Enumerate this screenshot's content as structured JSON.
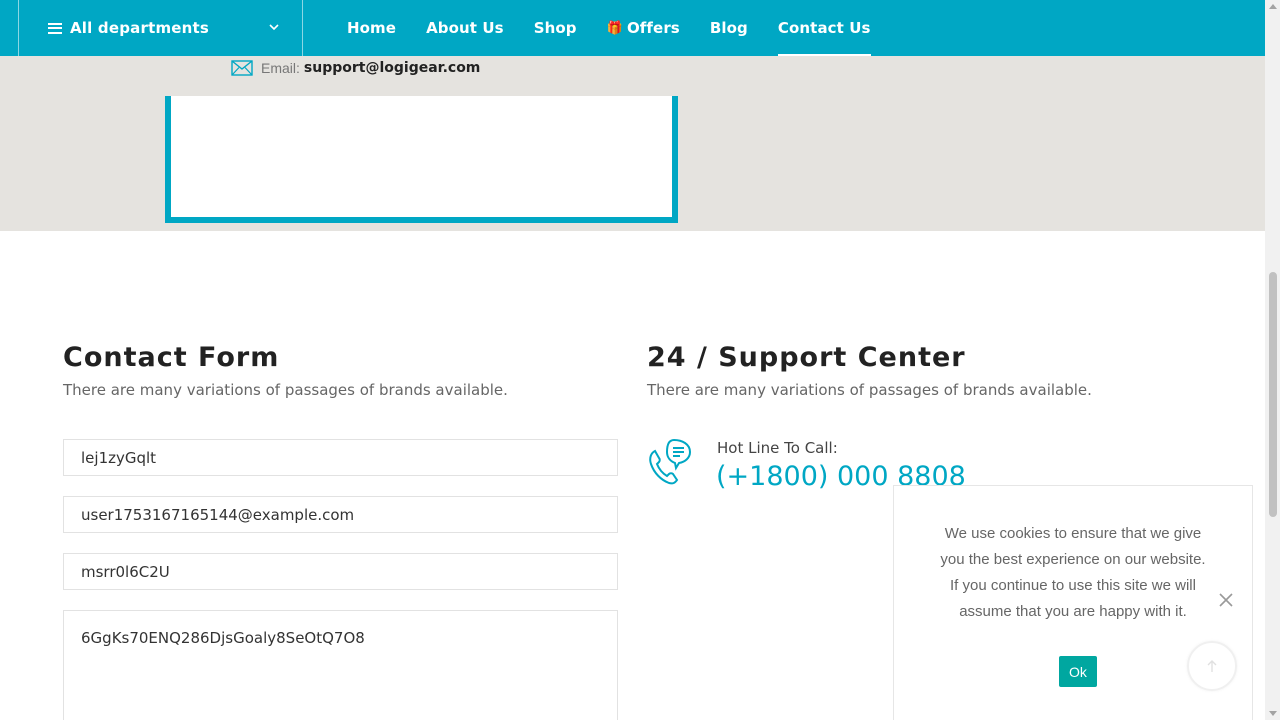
{
  "header": {
    "departments_label": "All departments",
    "nav": [
      {
        "label": "Home",
        "active": false
      },
      {
        "label": "About Us",
        "active": false
      },
      {
        "label": "Shop",
        "active": false
      },
      {
        "label": "Offers",
        "active": false,
        "icon": "gift-icon"
      },
      {
        "label": "Blog",
        "active": false
      },
      {
        "label": "Contact Us",
        "active": true
      }
    ]
  },
  "info_box": {
    "email_label": "Email:",
    "email_value": "support@logigear.com"
  },
  "contact_form": {
    "title": "Contact Form",
    "subtitle": "There are many variations of passages of brands available.",
    "name_value": "lej1zyGqlt",
    "email_value": "user1753167165144@example.com",
    "subject_value": "msrr0l6C2U",
    "message_value": "6GgKs70ENQ286DjsGoaly8SeOtQ7O8"
  },
  "support": {
    "title": "24 / Support Center",
    "subtitle": "There are many variations of passages of brands available.",
    "hotline_label": "Hot Line To Call:",
    "hotline_number": "(+1800) 000 8808"
  },
  "cookie": {
    "message": "We use cookies to ensure that we give you the best experience on our website. If you continue to use this site we will assume that you are happy with it.",
    "ok_label": "Ok"
  },
  "colors": {
    "brand": "#00a7c4",
    "ok_button": "#00a7a0",
    "map_bg": "#e5e3df"
  }
}
